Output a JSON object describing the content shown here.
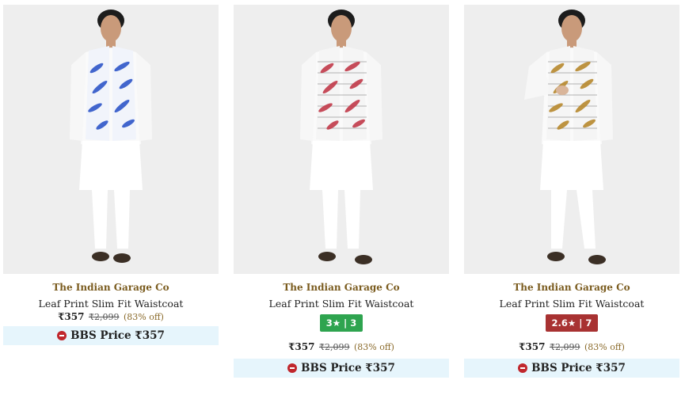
{
  "products": [
    {
      "brand": "The Indian Garage Co",
      "title": "Leaf Print Slim Fit Waistcoat",
      "price": "₹357",
      "mrp": "₹2,099",
      "discount": "(83% off)",
      "rating": "",
      "bbs_label": "BBS Price ₹357",
      "print_color": "#2f56c9"
    },
    {
      "brand": "The Indian Garage Co",
      "title": "Leaf Print Slim Fit Waistcoat",
      "price": "₹357",
      "mrp": "₹2,099",
      "discount": "(83% off)",
      "rating": "3★ | 3",
      "bbs_label": "BBS Price ₹357",
      "print_color": "#c23a4a"
    },
    {
      "brand": "The Indian Garage Co",
      "title": "Leaf Print Slim Fit Waistcoat",
      "price": "₹357",
      "mrp": "₹2,099",
      "discount": "(83% off)",
      "rating": "2.6★ | 7",
      "bbs_label": "BBS Price ₹357",
      "print_color": "#b8892e"
    }
  ]
}
